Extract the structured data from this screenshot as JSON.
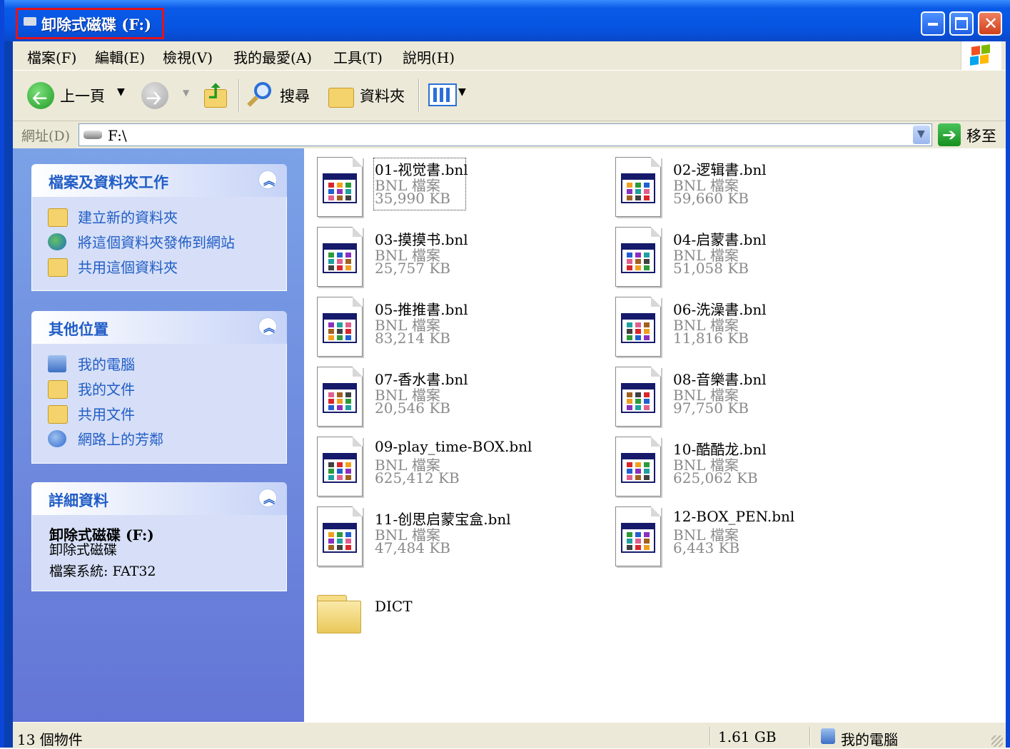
{
  "window": {
    "title": "卸除式磁碟 (F:)",
    "buttons": {
      "minimize": "minimize",
      "maximize": "maximize",
      "close": "close"
    }
  },
  "menu": {
    "items": [
      "檔案(F)",
      "編輯(E)",
      "檢視(V)",
      "我的最愛(A)",
      "工具(T)",
      "說明(H)"
    ]
  },
  "toolbar": {
    "back_label": "上一頁",
    "search_label": "搜尋",
    "folders_label": "資料夾"
  },
  "address": {
    "label": "網址(D)",
    "value": "F:\\",
    "go_label": "移至"
  },
  "left_pane": {
    "tasks": {
      "title": "檔案及資料夾工作",
      "items": [
        "建立新的資料夾",
        "將這個資料夾發佈到網站",
        "共用這個資料夾"
      ]
    },
    "places": {
      "title": "其他位置",
      "items": [
        "我的電腦",
        "我的文件",
        "共用文件",
        "網路上的芳鄰"
      ]
    },
    "details": {
      "title": "詳細資料",
      "name": "卸除式磁碟 (F:)",
      "type": "卸除式磁碟",
      "filesystem": "檔案系統: FAT32"
    }
  },
  "files": [
    {
      "name": "01-视觉書.bnl",
      "type": "BNL 檔案",
      "size": "35,990 KB"
    },
    {
      "name": "02-逻辑書.bnl",
      "type": "BNL 檔案",
      "size": "59,660 KB"
    },
    {
      "name": "03-摸摸书.bnl",
      "type": "BNL 檔案",
      "size": "25,757 KB"
    },
    {
      "name": "04-启蒙書.bnl",
      "type": "BNL 檔案",
      "size": "51,058 KB"
    },
    {
      "name": "05-推推書.bnl",
      "type": "BNL 檔案",
      "size": "83,214 KB"
    },
    {
      "name": "06-洗澡書.bnl",
      "type": "BNL 檔案",
      "size": "11,816 KB"
    },
    {
      "name": "07-香水書.bnl",
      "type": "BNL 檔案",
      "size": "20,546 KB"
    },
    {
      "name": "08-音樂書.bnl",
      "type": "BNL 檔案",
      "size": "97,750 KB"
    },
    {
      "name": "09-play_time-BOX.bnl",
      "type": "BNL 檔案",
      "size": "625,412 KB"
    },
    {
      "name": "10-酷酷龙.bnl",
      "type": "BNL 檔案",
      "size": "625,062 KB"
    },
    {
      "name": "11-创思启蒙宝盒.bnl",
      "type": "BNL 檔案",
      "size": "47,484 KB"
    },
    {
      "name": "12-BOX_PEN.bnl",
      "type": "BNL 檔案",
      "size": "6,443 KB"
    }
  ],
  "folder": {
    "name": "DICT"
  },
  "status": {
    "count": "13 個物件",
    "size": "1.61 GB",
    "location": "我的電腦"
  },
  "colors": {
    "titlebar": "#0654e0",
    "highlight_box": "#e2141c",
    "task_link": "#215dc6",
    "left_pane": "#7ba2e7"
  }
}
